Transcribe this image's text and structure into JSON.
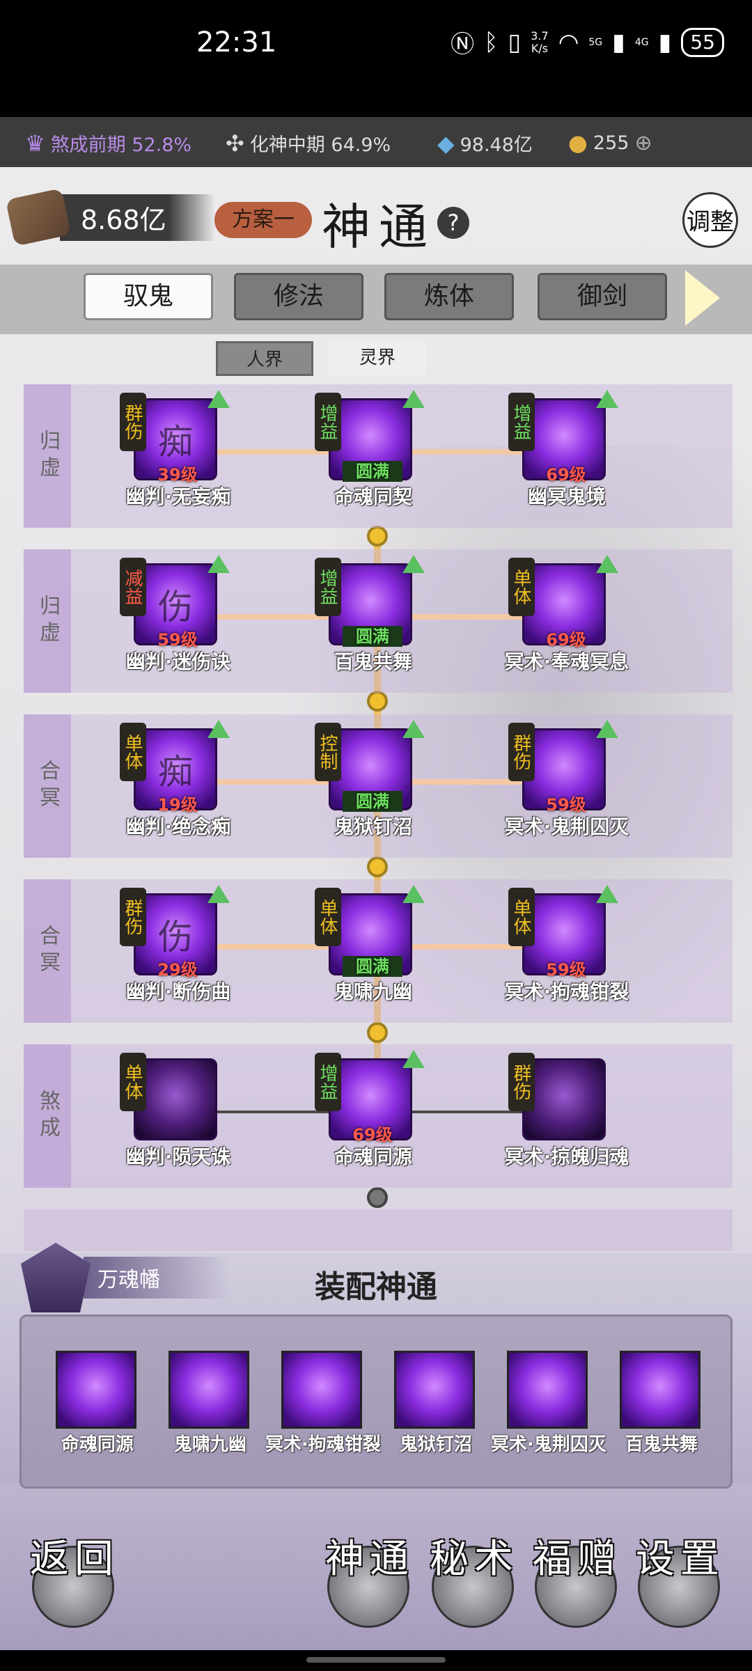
{
  "status": {
    "time": "22:31",
    "speed_top": "3.7",
    "speed_bottom": "K/s",
    "sig1": "5G",
    "sig2": "4G",
    "battery": "55"
  },
  "resources": [
    {
      "label": "煞成前期 52.8%",
      "icon": "soul-icon"
    },
    {
      "label": "化神中期 64.9%",
      "icon": "fan-icon"
    },
    {
      "label": "98.48亿",
      "icon": "crystal-icon"
    },
    {
      "label": "255",
      "icon": "coin-icon"
    }
  ],
  "header": {
    "currency": "8.68亿",
    "plan": "方案一",
    "title": "神通",
    "help": "?",
    "adjust": "调整"
  },
  "tabs": [
    "驭鬼",
    "修法",
    "炼体",
    "御剑"
  ],
  "subtabs": [
    "人界",
    "灵界"
  ],
  "rows": [
    {
      "label": "归虚",
      "skills": [
        {
          "tag": "群伤",
          "glyph": "痴",
          "lvl": "39级",
          "name": "幽判·无妄痴"
        },
        {
          "tag": "增益",
          "glyph": "",
          "lvl": "圆满",
          "name": "命魂同契"
        },
        {
          "tag": "增益",
          "glyph": "",
          "lvl": "69级",
          "name": "幽冥鬼境"
        }
      ]
    },
    {
      "label": "归虚",
      "skills": [
        {
          "tag": "减益",
          "glyph": "伤",
          "lvl": "59级",
          "name": "幽判·迷伤诀"
        },
        {
          "tag": "增益",
          "glyph": "",
          "lvl": "圆满",
          "name": "百鬼共舞"
        },
        {
          "tag": "单体",
          "glyph": "",
          "lvl": "69级",
          "name": "冥术·奉魂冥息"
        }
      ]
    },
    {
      "label": "合冥",
      "skills": [
        {
          "tag": "单体",
          "glyph": "痴",
          "lvl": "19级",
          "name": "幽判·绝念痴"
        },
        {
          "tag": "控制",
          "glyph": "",
          "lvl": "圆满",
          "name": "鬼狱钉沼"
        },
        {
          "tag": "群伤",
          "glyph": "",
          "lvl": "59级",
          "name": "冥术·鬼荆囚灭"
        }
      ]
    },
    {
      "label": "合冥",
      "skills": [
        {
          "tag": "群伤",
          "glyph": "伤",
          "lvl": "29级",
          "name": "幽判·断伤曲"
        },
        {
          "tag": "单体",
          "glyph": "",
          "lvl": "圆满",
          "name": "鬼啸九幽"
        },
        {
          "tag": "单体",
          "glyph": "",
          "lvl": "59级",
          "name": "冥术·拘魂钳裂"
        }
      ]
    },
    {
      "label": "煞成",
      "skills": [
        {
          "tag": "单体",
          "glyph": "",
          "lvl": "",
          "name": "幽判·陨天诛"
        },
        {
          "tag": "增益",
          "glyph": "",
          "lvl": "69级",
          "name": "命魂同源"
        },
        {
          "tag": "群伤",
          "glyph": "",
          "lvl": "",
          "name": "冥术·掠魄归魂"
        }
      ]
    }
  ],
  "equip": {
    "banner": "万魂幡",
    "title": "装配神通",
    "items": [
      "命魂同源",
      "鬼啸九幽",
      "冥术·拘魂钳裂",
      "鬼狱钉沼",
      "冥术·鬼荆囚灭",
      "百鬼共舞"
    ]
  },
  "nav": {
    "back": "返回",
    "items": [
      "神通",
      "秘术",
      "福赠",
      "设置"
    ]
  }
}
